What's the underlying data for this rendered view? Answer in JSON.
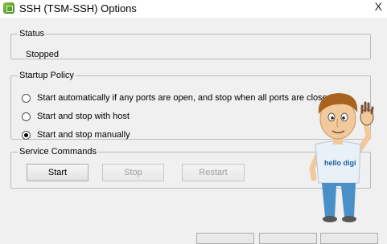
{
  "window": {
    "title": "SSH (TSM-SSH) Options",
    "close_glyph": "X",
    "app_icon": "vsphere-app-icon"
  },
  "status": {
    "legend": "Status",
    "value": "Stopped"
  },
  "startup_policy": {
    "legend": "Startup Policy",
    "options": [
      {
        "label": "Start automatically if any ports are open, and stop when all ports are closed",
        "checked": false
      },
      {
        "label": "Start and stop with host",
        "checked": false
      },
      {
        "label": "Start and stop manually",
        "checked": true
      }
    ]
  },
  "service_commands": {
    "legend": "Service Commands",
    "start_label": "Start",
    "stop_label": "Stop",
    "restart_label": "Restart"
  },
  "mascot": {
    "shirt_text": "hello digi"
  },
  "colors": {
    "app_icon": "#6fb33a",
    "shirt": "#e8f0f8",
    "pants": "#4a90c8",
    "hair": "#a8641e",
    "skin": "#f2c99a"
  }
}
